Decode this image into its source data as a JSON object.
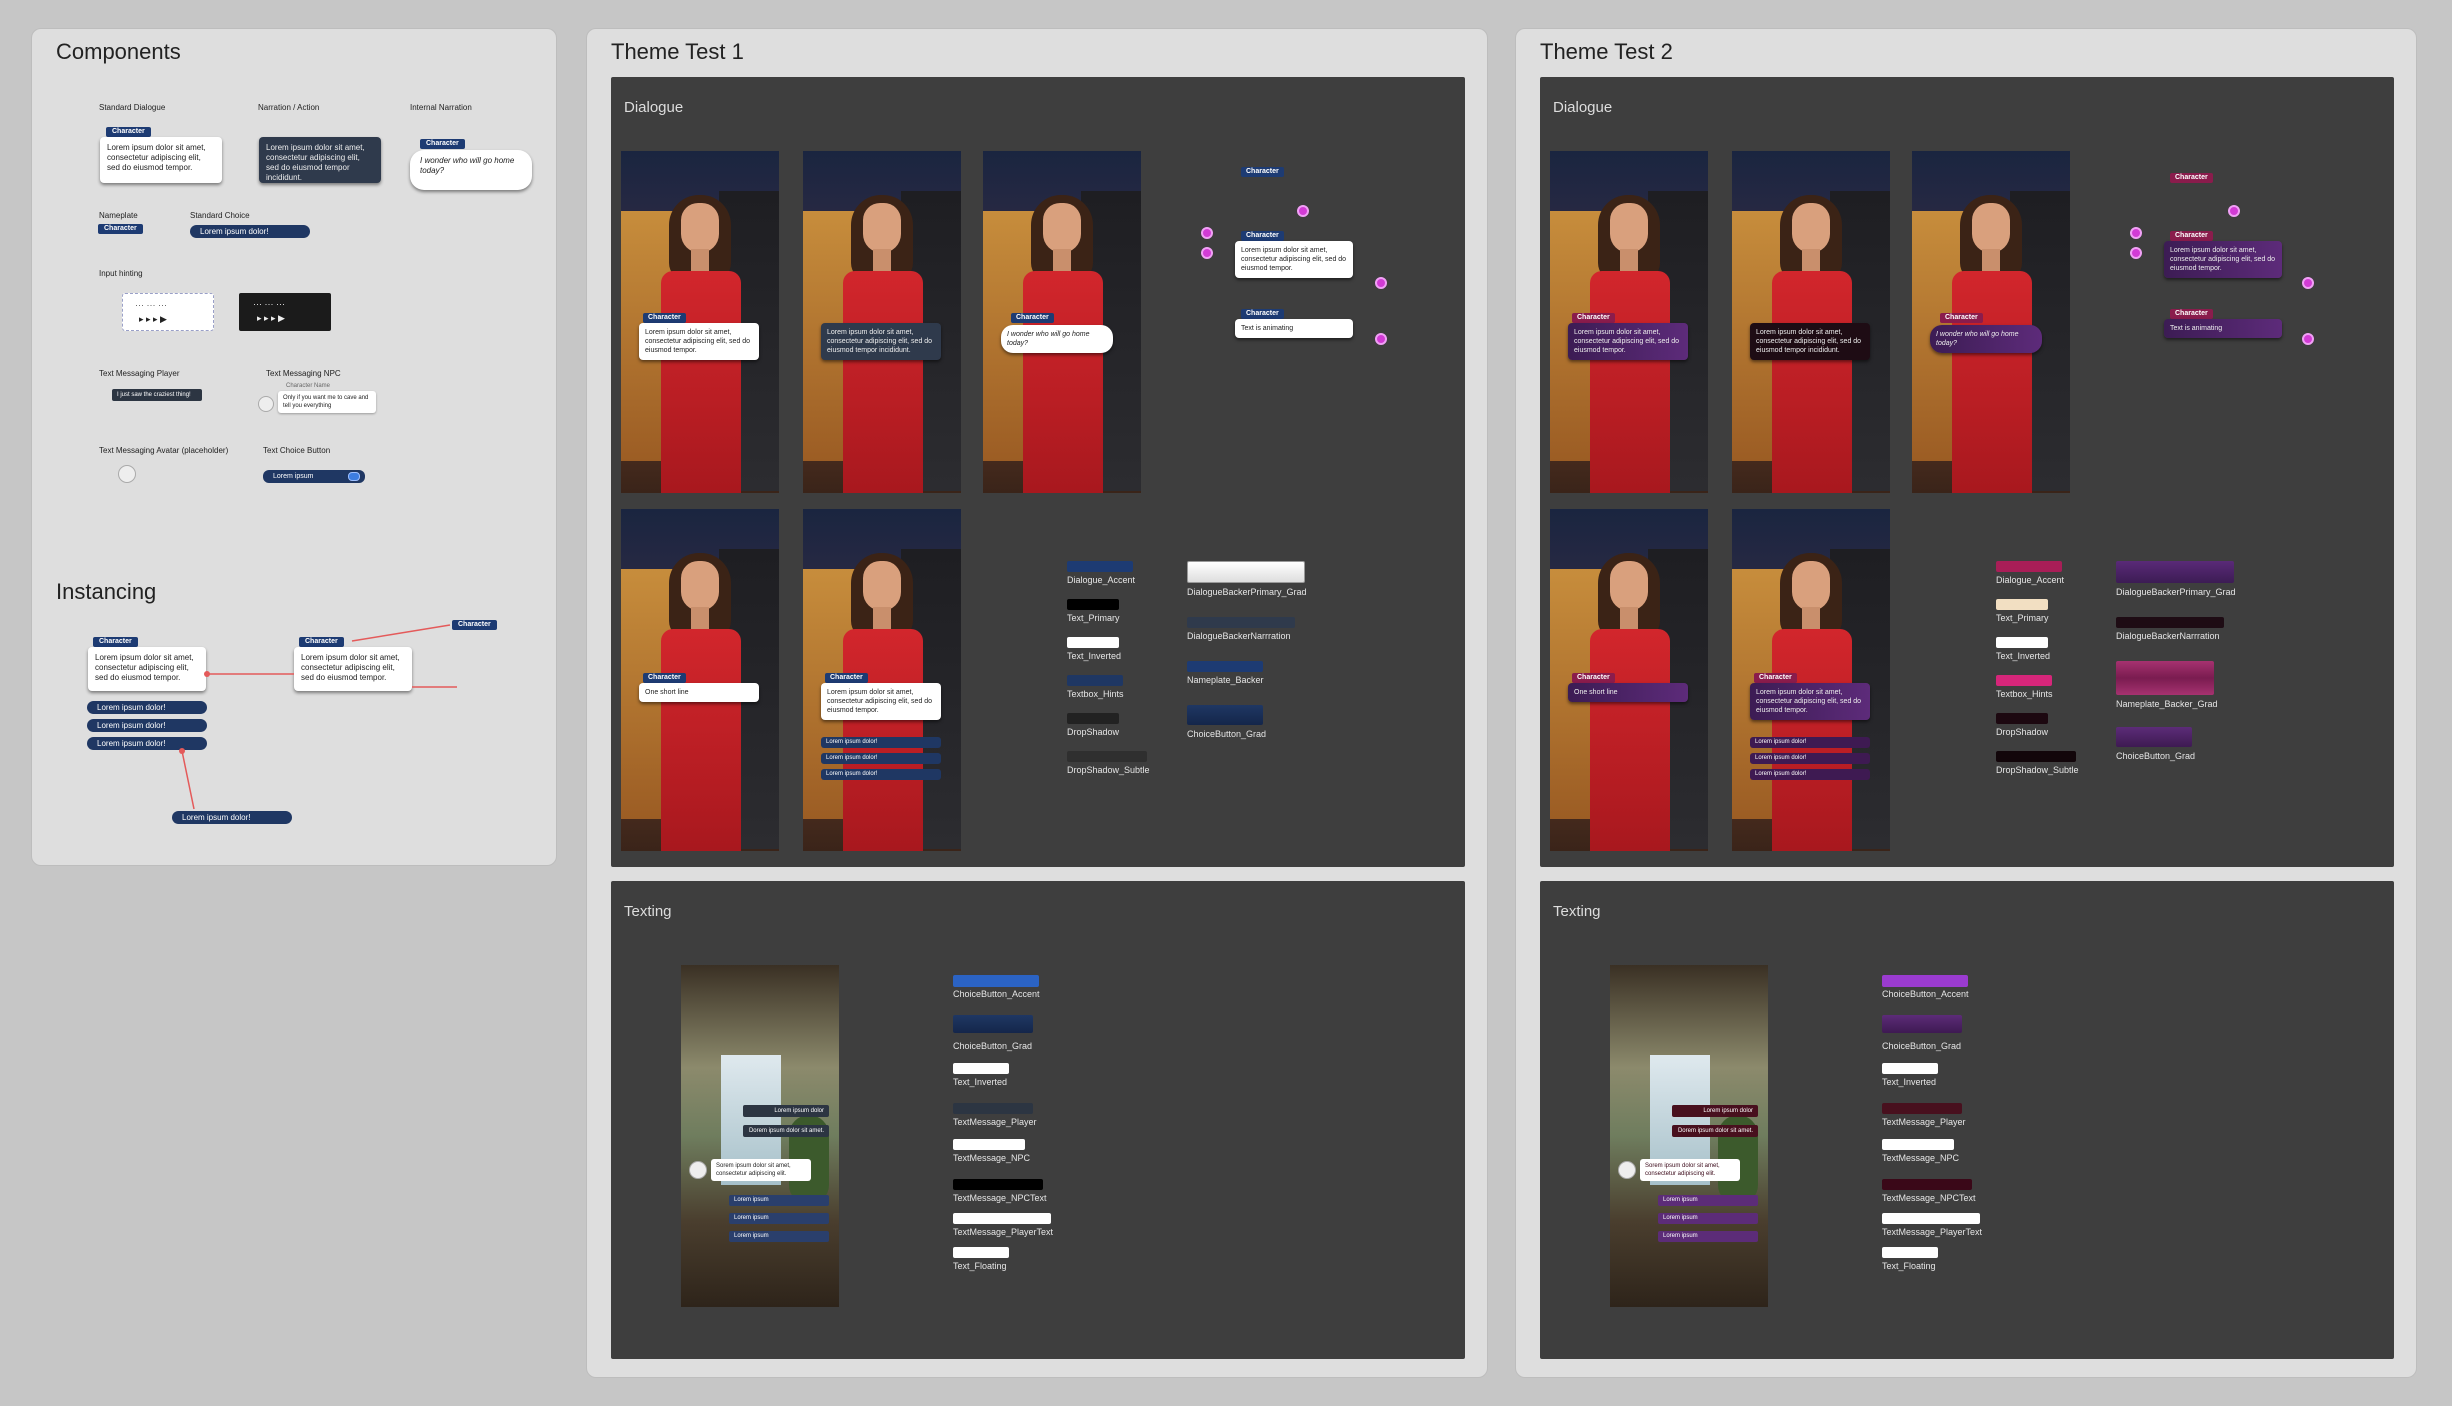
{
  "components": {
    "title": "Components",
    "standard_dialogue": {
      "label": "Standard Dialogue",
      "name": "Character",
      "text": "Lorem ipsum dolor sit amet, consectetur adipiscing elit, sed do eiusmod tempor."
    },
    "narration": {
      "label": "Narration / Action",
      "text": "Lorem ipsum dolor sit amet, consectetur adipiscing elit, sed do eiusmod tempor incididunt."
    },
    "internal": {
      "label": "Internal Narration",
      "name": "Character",
      "text": "I wonder who will go home today?"
    },
    "nameplate": {
      "label": "Nameplate",
      "name": "Character"
    },
    "standard_choice": {
      "label": "Standard Choice",
      "text": "Lorem ipsum dolor!"
    },
    "input_hinting": {
      "label": "Input hinting"
    },
    "text_player": {
      "label": "Text Messaging Player",
      "text": "I just saw the craziest thing!"
    },
    "text_npc": {
      "label": "Text Messaging NPC",
      "sender": "Character Name",
      "text": "Only if you want me to cave and tell you everything"
    },
    "text_avatar": {
      "label": "Text Messaging Avatar (placeholder)"
    },
    "text_choice": {
      "label": "Text Choice Button",
      "text": "Lorem ipsum"
    }
  },
  "instancing": {
    "title": "Instancing",
    "name": "Character",
    "text": "Lorem ipsum dolor sit amet, consectetur adipiscing elit, sed do eiusmod tempor.",
    "choices": [
      "Lorem ipsum dolor!",
      "Lorem ipsum dolor!",
      "Lorem ipsum dolor!"
    ],
    "result_choice": "Lorem ipsum dolor!"
  },
  "theme1": {
    "title": "Theme Test 1",
    "dialogue_title": "Dialogue",
    "texting_title": "Texting",
    "name": "Character",
    "dialogue_text": "Lorem ipsum dolor sit amet, consectetur adipiscing elit, sed do eiusmod tempor.",
    "dialogue_text_long": "Lorem ipsum dolor sit amet, consectetur adipiscing elit, sed do eiusmod tempor incididunt.",
    "internal_text": "I wonder who will go home today?",
    "animating_text": "Text is animating",
    "short_line": "One short line",
    "choice": "Lorem ipsum dolor!",
    "dialogue_swatches": [
      "Dialogue_Accent",
      "Text_Primary",
      "Text_Inverted",
      "Textbox_Hints",
      "DropShadow",
      "DropShadow_Subtle"
    ],
    "dialogue_swatches2": [
      "DialogueBackerPrimary_Grad",
      "DialogueBackerNarrration",
      "Nameplate_Backer",
      "ChoiceButton_Grad"
    ],
    "texting_swatches": [
      "ChoiceButton_Accent",
      "ChoiceButton_Grad",
      "Text_Inverted",
      "TextMessage_Player",
      "TextMessage_NPC",
      "TextMessage_NPCText",
      "TextMessage_PlayerText",
      "Text_Floating"
    ],
    "text_player_1": "Lorem ipsum dolor",
    "text_player_2": "Dorem ipsum dolor sit amet.",
    "text_npc_text": "Sorem ipsum dolor sit amet, consectetur adipiscing elit.",
    "text_choices": [
      "Lorem ipsum",
      "Lorem ipsum",
      "Lorem ipsum"
    ],
    "colors": {
      "accent": "#1d3b73",
      "text_primary": "#000000",
      "text_inverted": "#ffffff",
      "hints": "#1f3763",
      "shadow": "#222222",
      "shadow_subtle": "#2f2f2f",
      "backer_primary": "#ffffff",
      "backer_narration": "#2f3a4c",
      "nameplate": "#1d3b73",
      "choice_grad": "#1f3763",
      "choice_accent": "#2b63c4",
      "tm_player": "#2c3542",
      "tm_npc": "#ffffff",
      "tm_npctext": "#000000",
      "tm_playertext": "#ffffff",
      "floating": "#ffffff"
    }
  },
  "theme2": {
    "title": "Theme Test 2",
    "dialogue_title": "Dialogue",
    "texting_title": "Texting",
    "name": "Character",
    "dialogue_text": "Lorem ipsum dolor sit amet, consectetur adipiscing elit, sed do eiusmod tempor.",
    "dialogue_text_long": "Lorem ipsum dolor sit amet, consectetur adipiscing elit, sed do eiusmod tempor incididunt.",
    "internal_text": "I wonder who will go home today?",
    "animating_text": "Text is animating",
    "short_line": "One short line",
    "choice": "Lorem ipsum dolor!",
    "dialogue_swatches": [
      "Dialogue_Accent",
      "Text_Primary",
      "Text_Inverted",
      "Textbox_Hints",
      "DropShadow",
      "DropShadow_Subtle"
    ],
    "dialogue_swatches2": [
      "DialogueBackerPrimary_Grad",
      "DialogueBackerNarrration",
      "Nameplate_Backer_Grad",
      "ChoiceButton_Grad"
    ],
    "texting_swatches": [
      "ChoiceButton_Accent",
      "ChoiceButton_Grad",
      "Text_Inverted",
      "TextMessage_Player",
      "TextMessage_NPC",
      "TextMessage_NPCText",
      "TextMessage_PlayerText",
      "Text_Floating"
    ],
    "text_player_1": "Lorem ipsum dolor",
    "text_player_2": "Dorem ipsum dolor sit amet.",
    "text_npc_text": "Sorem ipsum dolor sit amet, consectetur adipiscing elit.",
    "text_choices": [
      "Lorem ipsum",
      "Lorem ipsum",
      "Lorem ipsum"
    ],
    "colors": {
      "accent": "#a81e57",
      "text_primary": "#f2dfc2",
      "text_inverted": "#ffffff",
      "hints": "#d6267a",
      "shadow": "#1c0810",
      "shadow_subtle": "#12060a",
      "backer_primary": "#5a2a78",
      "backer_narration": "#1e0c14",
      "nameplate": "#8a1c4c",
      "choice_grad": "#5c2c78",
      "choice_accent": "#9a3bd0",
      "tm_player": "#48101e",
      "tm_npc": "#ffffff",
      "tm_npctext": "#3a0818",
      "tm_playertext": "#ffffff",
      "floating": "#ffffff"
    }
  }
}
